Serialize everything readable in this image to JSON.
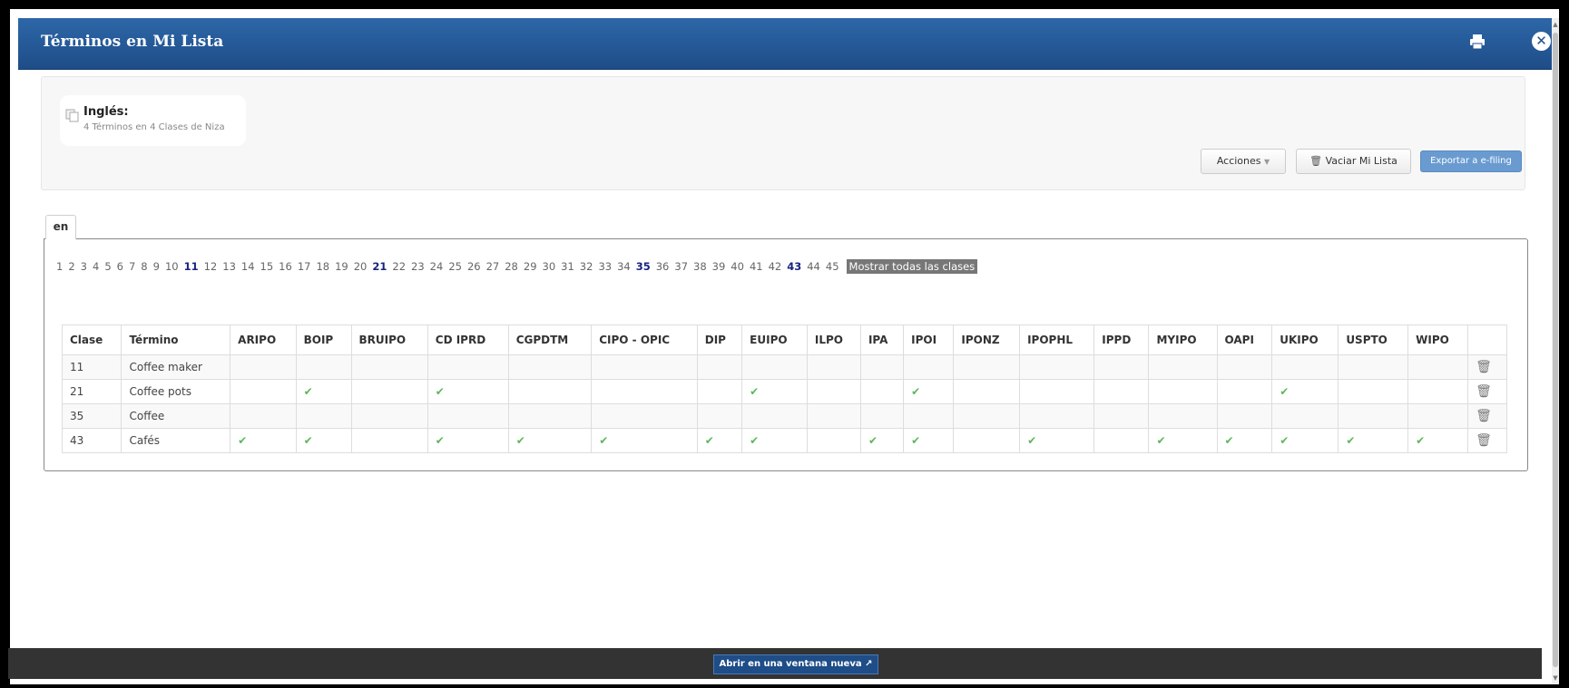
{
  "modal": {
    "title": "Términos en Mi Lista",
    "print_icon": "printer-icon",
    "close_icon": "close-icon"
  },
  "summary": {
    "language": "Inglés:",
    "subtitle": "4 Términos en 4 Clases de Niza"
  },
  "actions": {
    "acciones": "Acciones",
    "vaciar": "Vaciar Mi Lista",
    "exportar": "Exportar a e-filing"
  },
  "tab": {
    "label": "en"
  },
  "classes": {
    "numbers": [
      "1",
      "2",
      "3",
      "4",
      "5",
      "6",
      "7",
      "8",
      "9",
      "10",
      "11",
      "12",
      "13",
      "14",
      "15",
      "16",
      "17",
      "18",
      "19",
      "20",
      "21",
      "22",
      "23",
      "24",
      "25",
      "26",
      "27",
      "28",
      "29",
      "30",
      "31",
      "32",
      "33",
      "34",
      "35",
      "36",
      "37",
      "38",
      "39",
      "40",
      "41",
      "42",
      "43",
      "44",
      "45"
    ],
    "active": [
      "11",
      "21",
      "35",
      "43"
    ],
    "show_all": "Mostrar todas las clases"
  },
  "table": {
    "headers": [
      "Clase",
      "Término",
      "ARIPO",
      "BOIP",
      "BRUIPO",
      "CD IPRD",
      "CGPDTM",
      "CIPO - OPIC",
      "DIP",
      "EUIPO",
      "ILPO",
      "IPA",
      "IPOI",
      "IPONZ",
      "IPOPHL",
      "IPPD",
      "MYIPO",
      "OAPI",
      "UKIPO",
      "USPTO",
      "WIPO",
      ""
    ],
    "rows": [
      {
        "clase": "11",
        "termino": "Coffee maker",
        "checks": [
          false,
          false,
          false,
          false,
          false,
          false,
          false,
          false,
          false,
          false,
          false,
          false,
          false,
          false,
          false,
          false,
          false,
          false,
          false
        ]
      },
      {
        "clase": "21",
        "termino": "Coffee pots",
        "checks": [
          false,
          true,
          false,
          true,
          false,
          false,
          false,
          true,
          false,
          false,
          true,
          false,
          false,
          false,
          false,
          false,
          true,
          false,
          false
        ]
      },
      {
        "clase": "35",
        "termino": "Coffee",
        "checks": [
          false,
          false,
          false,
          false,
          false,
          false,
          false,
          false,
          false,
          false,
          false,
          false,
          false,
          false,
          false,
          false,
          false,
          false,
          false
        ]
      },
      {
        "clase": "43",
        "termino": "Cafés",
        "checks": [
          true,
          true,
          false,
          true,
          true,
          true,
          true,
          true,
          false,
          true,
          true,
          false,
          true,
          false,
          true,
          true,
          true,
          true,
          true
        ]
      }
    ]
  },
  "footer": {
    "open_new_window": "Abrir en una ventana nueva"
  }
}
